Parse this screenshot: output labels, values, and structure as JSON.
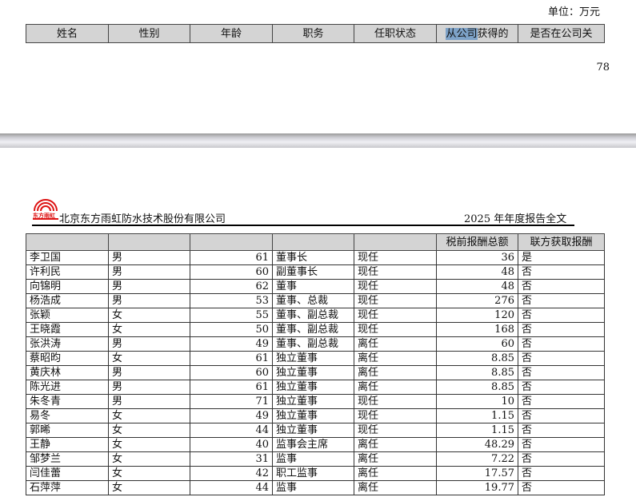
{
  "page1": {
    "unit": "单位：万元",
    "headers": [
      "姓名",
      "性别",
      "年龄",
      "职务",
      "任职状态",
      "从公司获得的",
      "是否在公司关"
    ],
    "selected_text": "从公司",
    "page_number": "78"
  },
  "page2": {
    "logo_text": "东方雨虹",
    "company": "北京东方雨虹防水技术股份有限公司",
    "report": "2025 年年度报告全文",
    "headers": [
      "",
      "",
      "",
      "",
      "",
      "税前报酬总额",
      "联方获取报酬"
    ],
    "rows": [
      [
        "李卫国",
        "男",
        "61",
        "董事长",
        "现任",
        "36",
        "是"
      ],
      [
        "许利民",
        "男",
        "60",
        "副董事长",
        "现任",
        "48",
        "否"
      ],
      [
        "向锦明",
        "男",
        "62",
        "董事",
        "现任",
        "48",
        "否"
      ],
      [
        "杨浩成",
        "男",
        "53",
        "董事、总裁",
        "现任",
        "276",
        "否"
      ],
      [
        "张颖",
        "女",
        "55",
        "董事、副总裁",
        "现任",
        "120",
        "否"
      ],
      [
        "王晓霞",
        "女",
        "50",
        "董事、副总裁",
        "现任",
        "168",
        "否"
      ],
      [
        "张洪涛",
        "男",
        "49",
        "董事、副总裁",
        "离任",
        "60",
        "否"
      ],
      [
        "蔡昭昀",
        "女",
        "61",
        "独立董事",
        "离任",
        "8.85",
        "否"
      ],
      [
        "黄庆林",
        "男",
        "60",
        "独立董事",
        "离任",
        "8.85",
        "否"
      ],
      [
        "陈光进",
        "男",
        "61",
        "独立董事",
        "离任",
        "8.85",
        "否"
      ],
      [
        "朱冬青",
        "男",
        "71",
        "独立董事",
        "现任",
        "10",
        "否"
      ],
      [
        "易冬",
        "女",
        "49",
        "独立董事",
        "现任",
        "1.15",
        "否"
      ],
      [
        "郭晞",
        "女",
        "44",
        "独立董事",
        "现任",
        "1.15",
        "否"
      ],
      [
        "王静",
        "女",
        "40",
        "监事会主席",
        "离任",
        "48.29",
        "否"
      ],
      [
        "邹梦兰",
        "女",
        "31",
        "监事",
        "离任",
        "7.22",
        "否"
      ],
      [
        "闫佳蕾",
        "女",
        "42",
        "职工监事",
        "离任",
        "17.57",
        "否"
      ],
      [
        "石萍萍",
        "女",
        "44",
        "监事",
        "离任",
        "19.77",
        "否"
      ]
    ]
  }
}
